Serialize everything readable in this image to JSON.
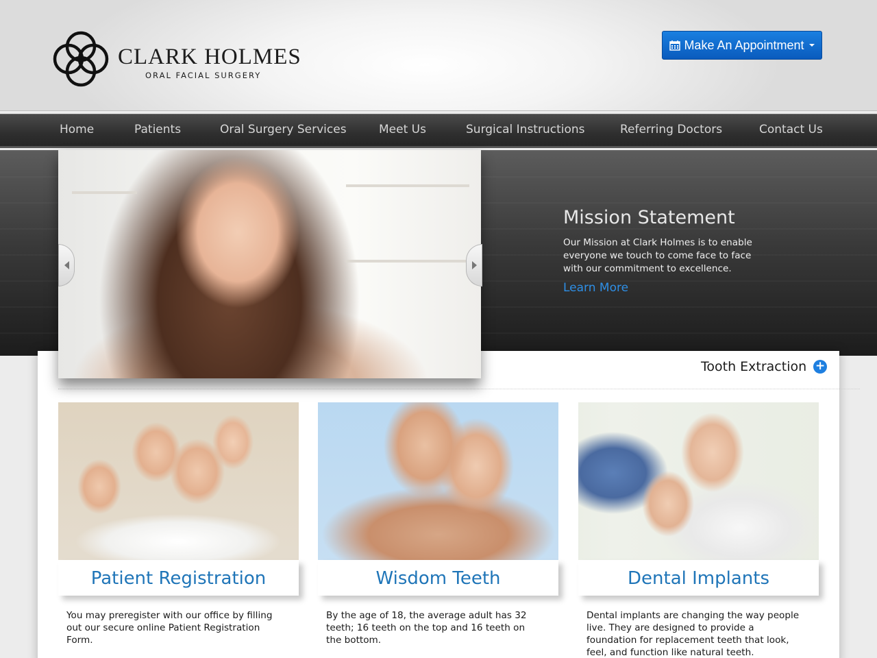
{
  "header": {
    "logo_name": "CLARK HOLMES",
    "logo_sub": "ORAL FACIAL SURGERY",
    "appointment_button": "Make An Appointment",
    "appointment_icon": "calendar-icon"
  },
  "nav": {
    "items": [
      "Home",
      "Patients",
      "Oral Surgery Services",
      "Meet Us",
      "Surgical Instructions",
      "Referring Doctors",
      "Contact Us"
    ]
  },
  "hero": {
    "title": "Mission Statement",
    "text": "Our Mission at Clark Holmes is to enable everyone we touch to come face to face with our commitment to excellence.",
    "link": "Learn More"
  },
  "content": {
    "tooth_link": "Tooth Extraction",
    "cards": [
      {
        "title": "Patient Registration",
        "text": "You may preregister with our office by filling out our secure online Patient Registration Form."
      },
      {
        "title": "Wisdom Teeth",
        "text": "By the age of 18, the average adult has 32 teeth; 16 teeth on the top and 16 teeth on the bottom."
      },
      {
        "title": "Dental Implants",
        "text": "Dental implants are changing the way people live. They are designed to provide a foundation for replacement teeth that look, feel, and function like natural teeth."
      }
    ]
  },
  "colors": {
    "accent_blue": "#1a7fe0",
    "link_blue": "#1f75b8",
    "nav_bg": "#2f2f2f"
  }
}
